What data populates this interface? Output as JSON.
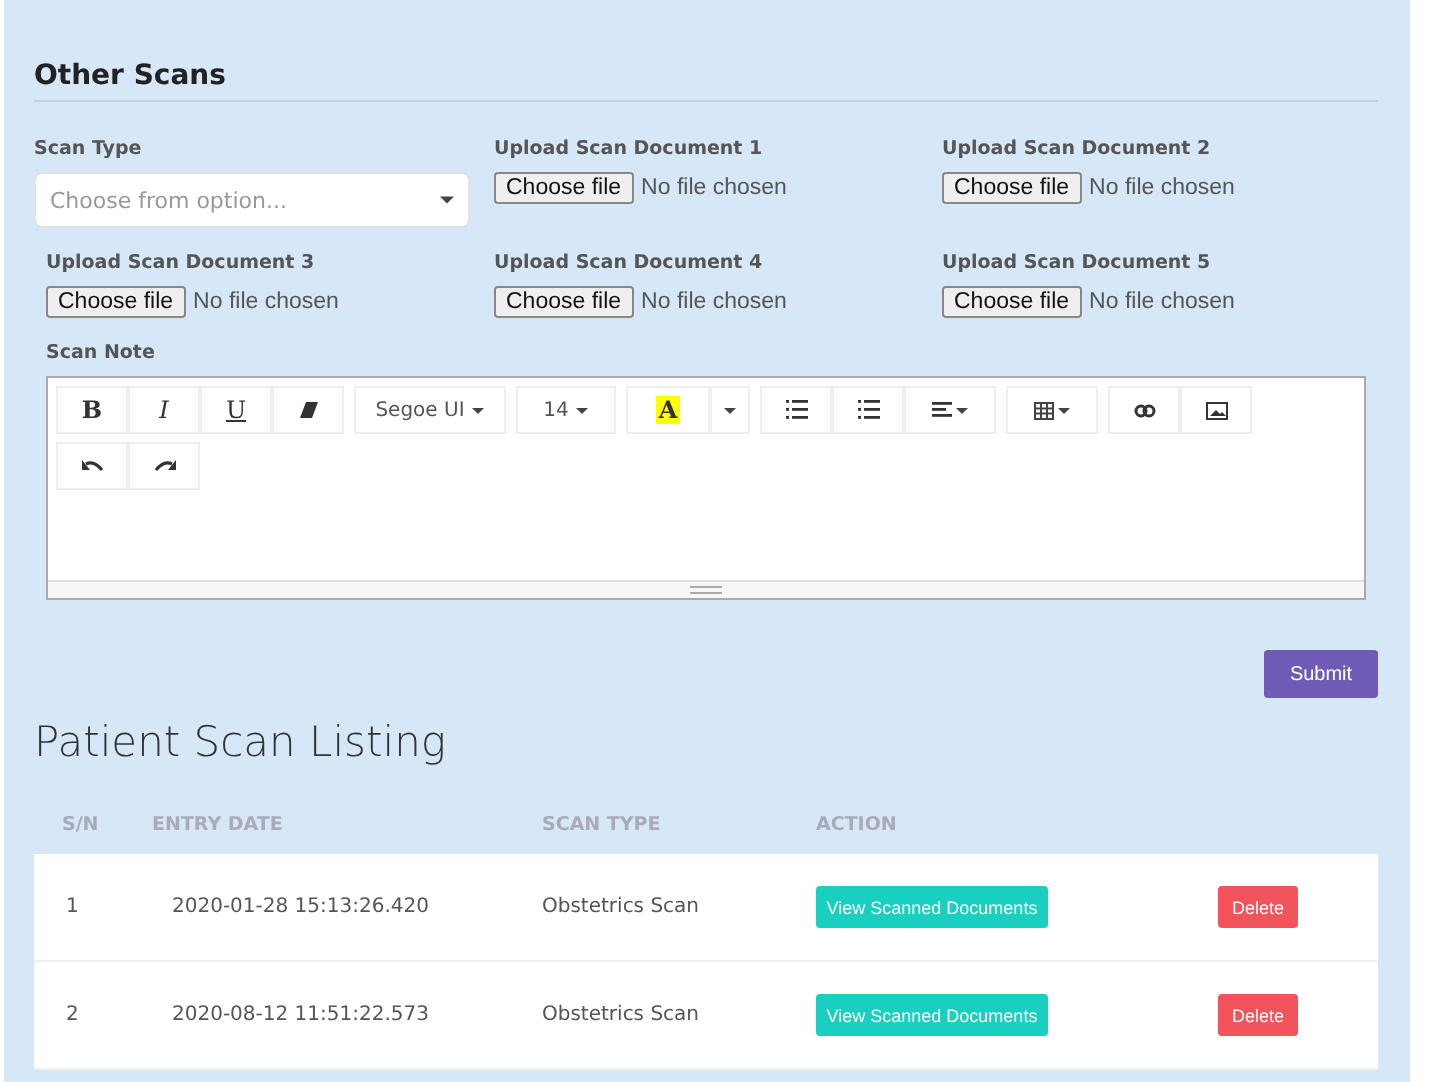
{
  "section": {
    "title": "Other Scans"
  },
  "scan_type": {
    "label": "Scan Type",
    "placeholder": "Choose from option..."
  },
  "uploads": [
    {
      "label": "Upload Scan Document 1",
      "button": "Choose file",
      "status": "No file chosen"
    },
    {
      "label": "Upload Scan Document 2",
      "button": "Choose file",
      "status": "No file chosen"
    },
    {
      "label": "Upload Scan Document 3",
      "button": "Choose file",
      "status": "No file chosen"
    },
    {
      "label": "Upload Scan Document 4",
      "button": "Choose file",
      "status": "No file chosen"
    },
    {
      "label": "Upload Scan Document 5",
      "button": "Choose file",
      "status": "No file chosen"
    }
  ],
  "scan_note": {
    "label": "Scan Note",
    "toolbar": {
      "bold": "B",
      "italic": "I",
      "underline": "U",
      "font": "Segoe UI",
      "size": "14",
      "highlight": "A"
    }
  },
  "submit": "Submit",
  "listing": {
    "title": "Patient Scan Listing",
    "columns": [
      "S/N",
      "ENTRY DATE",
      "SCAN TYPE",
      "ACTION"
    ],
    "rows": [
      {
        "sn": "1",
        "entry_date": "2020-01-28 15:13:26.420",
        "scan_type": "Obstetrics Scan",
        "view": "View Scanned Documents",
        "delete": "Delete"
      },
      {
        "sn": "2",
        "entry_date": "2020-08-12 11:51:22.573",
        "scan_type": "Obstetrics Scan",
        "view": "View Scanned Documents",
        "delete": "Delete"
      }
    ]
  }
}
